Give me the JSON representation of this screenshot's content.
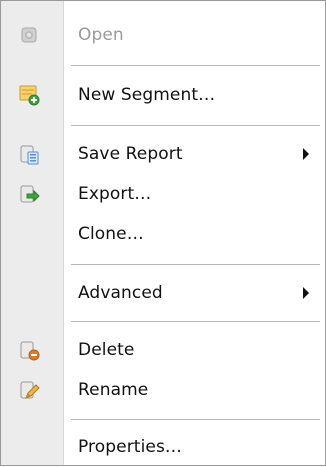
{
  "menu": {
    "open": "Open",
    "new_segment": "New Segment…",
    "save_report": "Save Report",
    "export": "Export…",
    "clone": "Clone…",
    "advanced": "Advanced",
    "delete": "Delete",
    "rename": "Rename",
    "properties": "Properties…"
  },
  "icons": {
    "open": "open-disabled-icon",
    "new_segment": "new-segment-icon",
    "save_report": "save-report-icon",
    "export": "export-icon",
    "delete": "delete-icon",
    "rename": "rename-icon"
  },
  "colors": {
    "gutter": "#ececec",
    "separator": "#b8b8b8",
    "text": "#111111",
    "disabled_text": "#9a9a9a",
    "accent_green": "#3aa53a",
    "accent_orange": "#e07b24"
  }
}
